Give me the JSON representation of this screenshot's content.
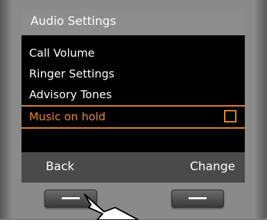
{
  "screen": {
    "title": "Audio Settings",
    "menu_items": [
      {
        "label": "Call Volume",
        "selected": false
      },
      {
        "label": "Ringer Settings",
        "selected": false
      },
      {
        "label": "Advisory Tones",
        "selected": false
      },
      {
        "label": "Music on hold",
        "selected": true,
        "checked": false
      }
    ]
  },
  "softkeys": {
    "left_label": "Back",
    "right_label": "Change"
  },
  "colors": {
    "accent": "#e8882a",
    "title_bar": "#8d8d8d",
    "softkey_bar": "#4a4a4a",
    "screen_bg": "#000000"
  }
}
